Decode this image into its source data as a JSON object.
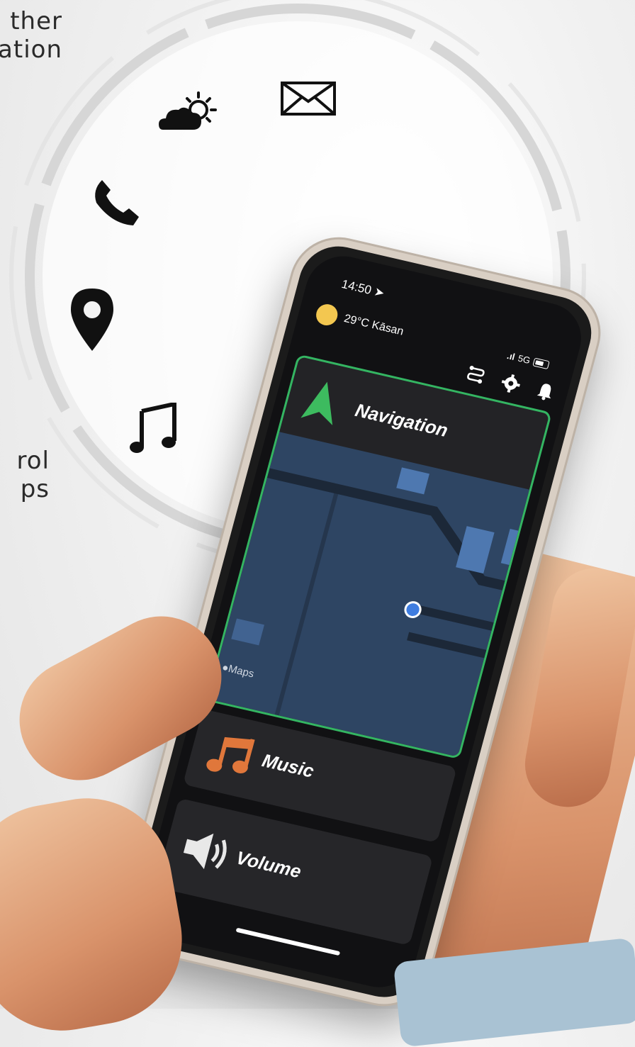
{
  "background_text": {
    "line1": "ther",
    "line2": "ation",
    "line3": "rol",
    "line4": "ps"
  },
  "floating_icons": [
    "weather-icon",
    "mail-icon",
    "phone-icon",
    "location-pin-icon",
    "music-note-icon"
  ],
  "phone": {
    "status": {
      "time": "14:50",
      "signal": "5G"
    },
    "weather": {
      "text": "29°C Kāsan"
    },
    "top_icons": [
      "route-icon",
      "gear-icon",
      "bell-icon"
    ],
    "cards": {
      "navigation": {
        "label": "Navigation",
        "map_credit": "Maps"
      },
      "music": {
        "label": "Music"
      },
      "volume": {
        "label": "Volume"
      }
    }
  },
  "colors": {
    "nav_accent": "#34b562",
    "music_accent": "#e0773b",
    "map_bg": "#2e4563",
    "sun": "#f3c750"
  }
}
